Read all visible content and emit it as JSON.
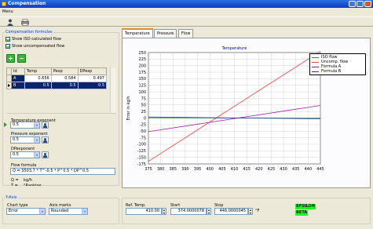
{
  "window": {
    "title": "Compensation"
  },
  "menu": {
    "label": "Menu"
  },
  "toolbar": {
    "icons": [
      "user-icon",
      "print-icon"
    ]
  },
  "formulas_group": {
    "title": "Compensation formulas",
    "show_iso_label": "Show ISO calculated flow",
    "show_uncomp_label": "Show uncompensated flow",
    "show_iso_checked": true,
    "show_uncomp_checked": true,
    "table": {
      "headers": [
        "Id",
        "Temp",
        "Pexp",
        "DPexp"
      ],
      "rows": [
        {
          "id": "A",
          "temp": "0.656",
          "pexp": "0.584",
          "dpexp": "0.497"
        },
        {
          "id": "B",
          "temp": "0.5",
          "pexp": "0.5",
          "dpexp": "0.5"
        }
      ]
    },
    "temp_exponent": {
      "label": "Temperature exponent",
      "value": "0.5"
    },
    "pressure_exponent": {
      "label": "Pressure exponent",
      "value": "0.5"
    },
    "dp_exponent": {
      "label": "DPexponent",
      "value": "0.5"
    },
    "flow_formula": {
      "label": "Flow formula",
      "value": "Q = 3503.7 * T^-0.5 * P^0.5 * DP^0.5",
      "legend": [
        {
          "sym": "Q =",
          "desc": "kg/h"
        },
        {
          "sym": "T =",
          "desc": "°Rankine"
        }
      ]
    }
  },
  "axis_group": {
    "title": "Y-Axis",
    "chart_type": {
      "label": "Chart type",
      "value": "Error"
    },
    "axis_marks": {
      "label": "Axis marks",
      "value": "Rounded"
    }
  },
  "tabs": [
    {
      "label": "Temperature",
      "active": true
    },
    {
      "label": "Pressure",
      "active": false
    },
    {
      "label": "Flow",
      "active": false
    }
  ],
  "chart_data": {
    "type": "line",
    "title": "Temperature",
    "ylabel": "Error in kg/h",
    "xlabel": "",
    "xlim": [
      375,
      445
    ],
    "ylim": [
      -175,
      250
    ],
    "x_ticks": [
      375,
      380,
      385,
      390,
      395,
      400,
      405,
      410,
      415,
      420,
      425,
      430,
      435,
      440,
      445
    ],
    "y_ticks": [
      250,
      225,
      200,
      175,
      150,
      125,
      100,
      75,
      50,
      25,
      0,
      -25,
      -50,
      -75,
      -100,
      -125,
      -150,
      -175
    ],
    "grid": true,
    "legend_position": "top-right",
    "series": [
      {
        "name": "ISO flow",
        "color": "#2a9a2a",
        "x": [
          375,
          445
        ],
        "y": [
          0,
          0
        ]
      },
      {
        "name": "Uncomp. flow",
        "color": "#ff4040",
        "x": [
          375,
          445
        ],
        "y": [
          -165,
          255
        ]
      },
      {
        "name": "Formula A",
        "color": "#9a1f9a",
        "x": [
          375,
          445
        ],
        "y": [
          -52,
          48
        ]
      },
      {
        "name": "Formula B",
        "color": "#3030c0",
        "x": [
          375,
          445
        ],
        "y": [
          4,
          -3
        ]
      }
    ]
  },
  "bottom": {
    "ref_temp": {
      "label": "Ref. Temp.",
      "value": "410.00"
    },
    "start": {
      "label": "Start",
      "value": "374.0000078"
    },
    "stop": {
      "label": "Stop",
      "value": "446.0000045"
    },
    "unit": "°F",
    "badges": [
      "EPSILON",
      "BETA"
    ]
  }
}
